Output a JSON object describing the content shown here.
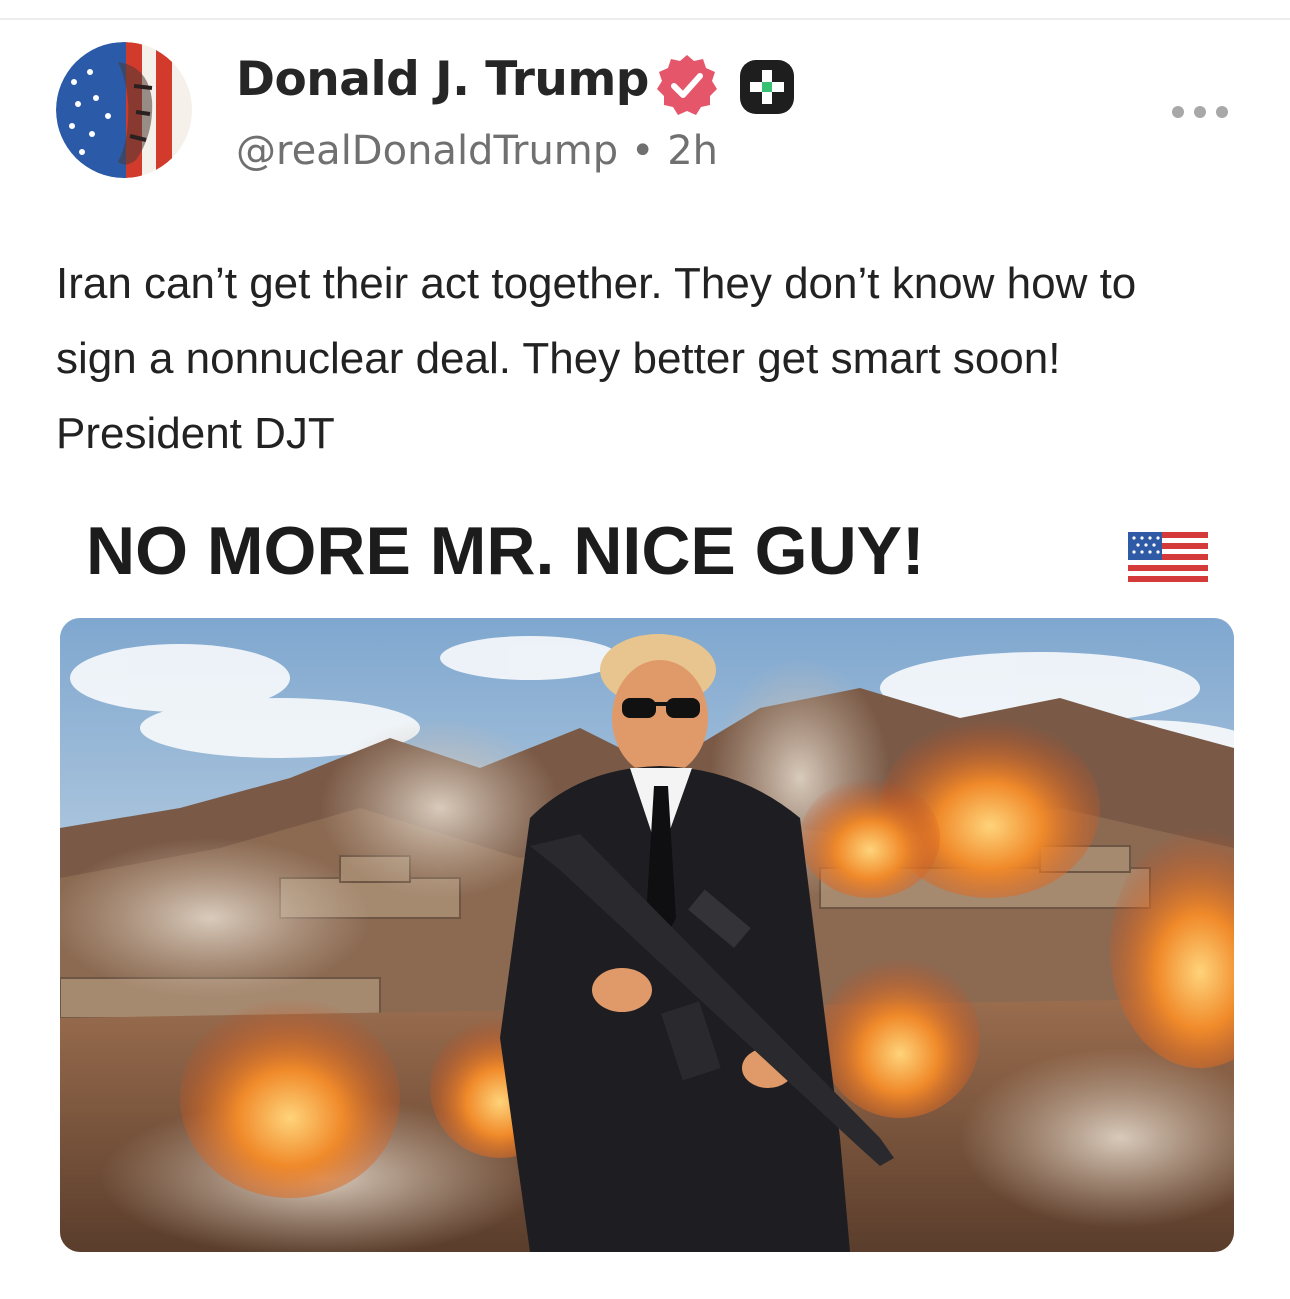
{
  "post": {
    "author_name": "Donald J. Trump",
    "handle": "@realDonaldTrump",
    "separator": "•",
    "time": "2h",
    "text": "Iran can’t get their act together. They don’t know how to sign a nonnuclear deal. They better get smart soon! President DJT",
    "media_headline": "NO MORE MR. NICE GUY!",
    "icons": {
      "avatar": "flag-portrait-avatar",
      "verified": "verified-badge-icon",
      "plus": "plus-badge-icon",
      "more": "more-horizontal-icon",
      "flag": "us-flag-emoji"
    },
    "colors": {
      "verified_badge": "#e5566b",
      "plus_badge": "#1e1e1e",
      "handle_text": "#707070"
    }
  }
}
